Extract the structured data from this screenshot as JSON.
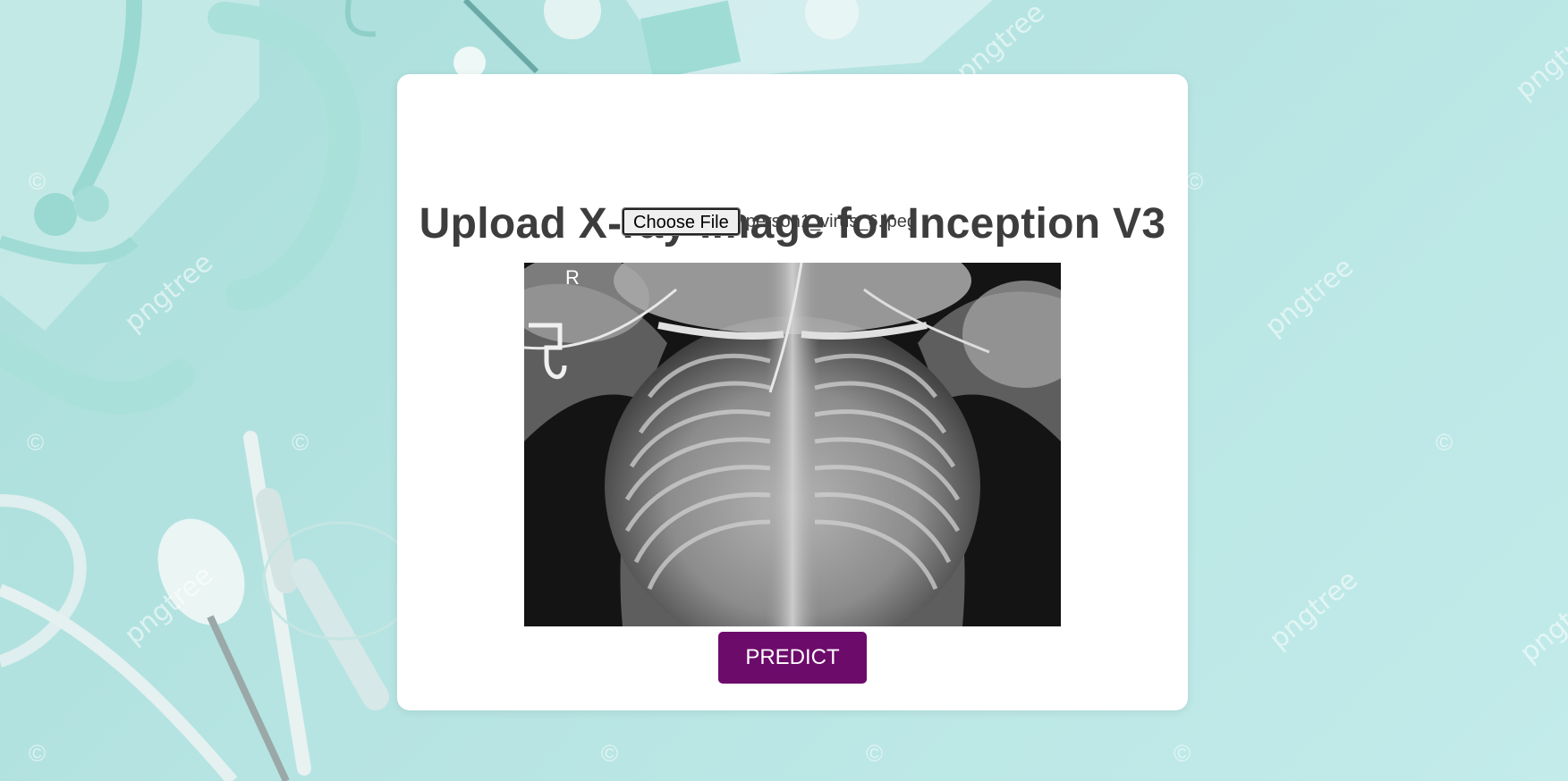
{
  "page": {
    "title": "Upload X-ray Image for Inception V3"
  },
  "file_input": {
    "button_label": "Choose File",
    "file_name": "person1_virus_6.jpeg"
  },
  "preview": {
    "marker_label": "R"
  },
  "actions": {
    "predict_label": "PREDICT"
  },
  "background": {
    "watermark_text": "pngtree",
    "watermark_symbol": "©"
  },
  "colors": {
    "background": "#b6e4e2",
    "card": "#ffffff",
    "title_text": "#3d3d3d",
    "predict_button": "#6d0b6b",
    "predict_text": "#ffffff"
  }
}
